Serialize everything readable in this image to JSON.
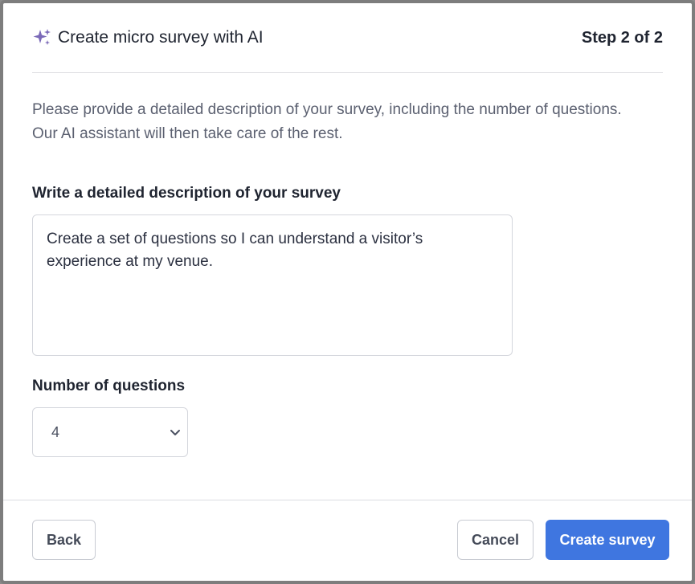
{
  "dialog": {
    "title": "Create micro survey with AI",
    "step": "Step 2 of 2",
    "title_icon": "sparkle-icon",
    "accent_color": "#7b6ab8"
  },
  "intro": {
    "text": "Please provide a detailed description of your survey, including the number of questions. Our AI assistant will then take care of the rest."
  },
  "description": {
    "label": "Write a detailed description of your survey",
    "value": "Create a set of questions so I can understand a visitor’s experience at my venue."
  },
  "questions": {
    "label": "Number of questions",
    "selected": "4",
    "icon": "chevron-down-icon"
  },
  "footer": {
    "back_label": "Back",
    "cancel_label": "Cancel",
    "create_label": "Create survey",
    "primary_color": "#3f76e0"
  }
}
